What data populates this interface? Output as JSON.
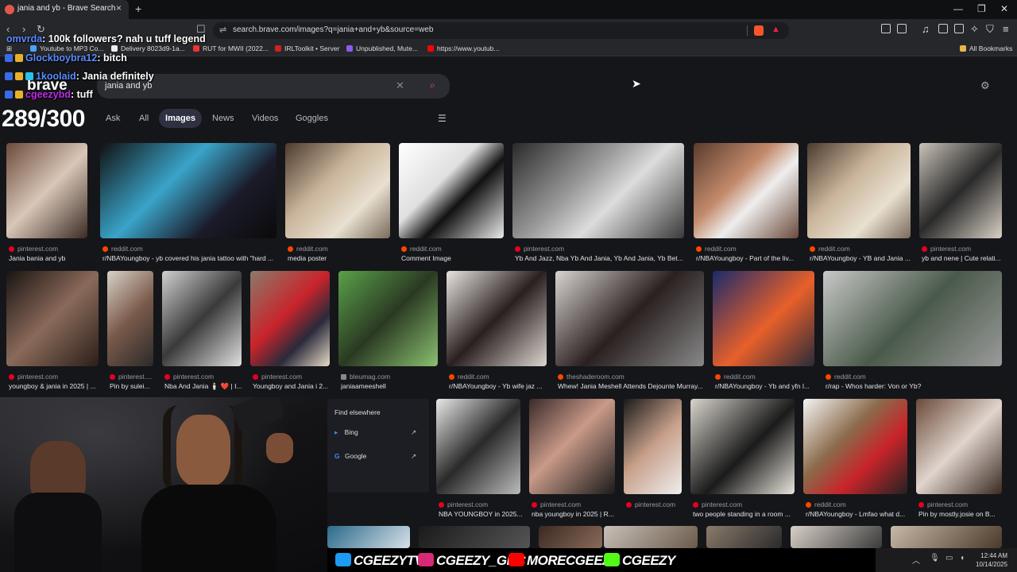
{
  "browser": {
    "tab_title": "jania and yb - Brave Search",
    "new_tab": "+",
    "close": "×",
    "url": "search.brave.com/images?q=jania+and+yb&source=web",
    "bookmarks": [
      "Youtube to MP3 Co...",
      "Delivery 8023d9-1a...",
      "RUT for MWII (2022...",
      "IRLToolkit • Server",
      "Unpublished, Mute...",
      "https://www.youtub..."
    ],
    "all_bookmarks": "All Bookmarks",
    "controls": {
      "minimize": "—",
      "maximize": "❐",
      "close": "✕"
    }
  },
  "search": {
    "logo": "brave",
    "query": "jania and yb",
    "tabs": {
      "ask": "Ask",
      "all": "All",
      "images": "Images",
      "news": "News",
      "videos": "Videos",
      "goggles": "Goggles"
    }
  },
  "overlay": {
    "counter": "289/300",
    "chat": [
      {
        "user": "omvrda",
        "msg": "100k followers? nah u tuff legend"
      },
      {
        "user": "Glockboybra12",
        "msg": "bitch"
      },
      {
        "user": "1koolaid",
        "msg": "Jania definitely"
      },
      {
        "user": "cgeezybd",
        "msg": "tuff"
      }
    ],
    "socials": [
      "CGEEZYTV",
      "CGEEZY_GBC",
      "MORECGEEZY",
      "CGEEZY"
    ]
  },
  "results": {
    "row1": [
      {
        "source": "pinterest.com",
        "caption": "Jania bania and yb"
      },
      {
        "source": "reddit.com",
        "caption": "r/NBAYoungboy - yb covered his jania tattoo with \"hard ..."
      },
      {
        "source": "reddit.com",
        "caption": "media poster"
      },
      {
        "source": "reddit.com",
        "caption": "Comment Image"
      },
      {
        "source": "pinterest.com",
        "caption": "Yb And Jazz, Nba Yb And Jania, Yb And Jania, Yb Bet..."
      },
      {
        "source": "reddit.com",
        "caption": "r/NBAYoungboy - Part of the liv..."
      },
      {
        "source": "reddit.com",
        "caption": "r/NBAYoungboy - YB and Jania ..."
      },
      {
        "source": "pinterest.com",
        "caption": "yb and nene | Cute relati..."
      }
    ],
    "row2": [
      {
        "source": "pinterest.com",
        "caption": "youngboy & jania in 2025 | ..."
      },
      {
        "source": "pinterest....",
        "caption": "Pin by sulei..."
      },
      {
        "source": "pinterest.com",
        "caption": "Nba And Jania 🕯️ ❤️ | I..."
      },
      {
        "source": "pinterest.com",
        "caption": "Youngboy and Jania i 2..."
      },
      {
        "source": "bleumag.com",
        "caption": "janiaameeshell"
      },
      {
        "source": "reddit.com",
        "caption": "r/NBAYoungboy - Yb wife jaz ..."
      },
      {
        "source": "theshaderoom.com",
        "caption": "Whew! Jania Meshell Attends Dejounte Murray..."
      },
      {
        "source": "reddit.com",
        "caption": "r/NBAYoungboy - Yb and yfn l..."
      },
      {
        "source": "reddit.com",
        "caption": "r/rap - Whos harder: Von or Yb?"
      }
    ],
    "row3": [
      {
        "source": "pinterest.com",
        "caption": "NBA YOUNGBOY in 2025..."
      },
      {
        "source": "pinterest.com",
        "caption": "nba youngboy in 2025 | R..."
      },
      {
        "source": "pinterest.com",
        "caption": ""
      },
      {
        "source": "pinterest.com",
        "caption": "two people standing in a room ..."
      },
      {
        "source": "reddit.com",
        "caption": "r/NBAYoungboy - Lmfao what d..."
      },
      {
        "source": "pinterest.com",
        "caption": "Pin by mostly.josie on B..."
      }
    ],
    "find_elsewhere": {
      "title": "Find elsewhere",
      "engines": [
        "Bing",
        "Google"
      ]
    }
  },
  "system": {
    "time": "12:44 AM",
    "date": "10/14/2025"
  }
}
